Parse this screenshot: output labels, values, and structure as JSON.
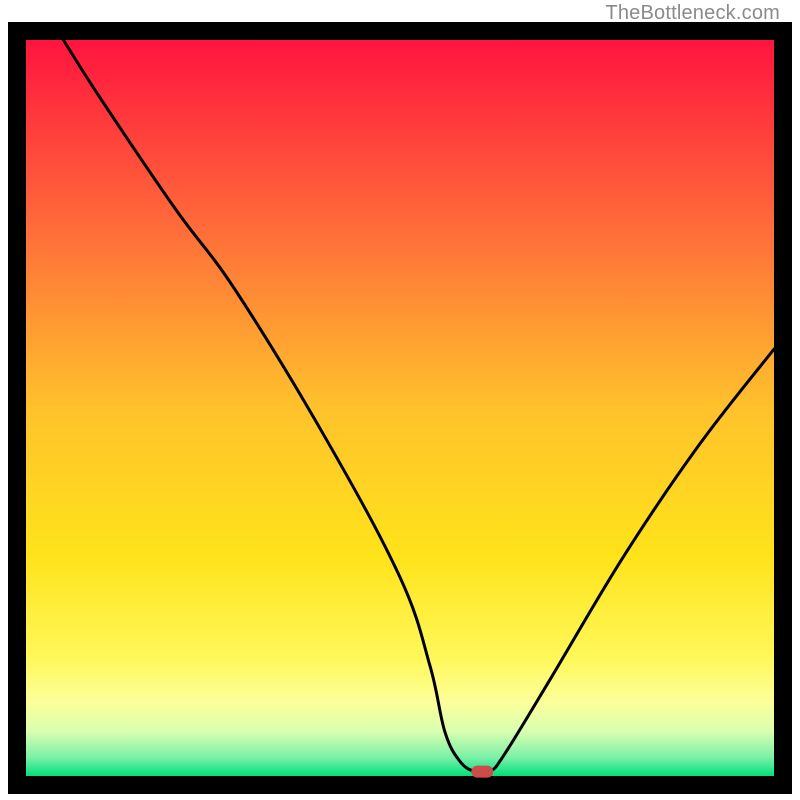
{
  "attribution": "TheBottleneck.com",
  "chart_data": {
    "type": "line",
    "title": "",
    "xlabel": "",
    "ylabel": "",
    "xlim": [
      0,
      100
    ],
    "ylim": [
      0,
      100
    ],
    "series": [
      {
        "name": "curve",
        "x": [
          5,
          10,
          20,
          28,
          40,
          50,
          54,
          56,
          58,
          60,
          62,
          64,
          70,
          80,
          90,
          100
        ],
        "y": [
          100,
          92,
          77,
          66,
          46,
          27,
          15,
          6,
          2,
          0.6,
          0.6,
          3,
          13,
          30,
          45,
          58
        ]
      }
    ],
    "marker": {
      "x": 61,
      "y": 0.6,
      "color": "#cc4b4b"
    },
    "gradient_stops": [
      {
        "offset": 0.0,
        "color": "#ff143e"
      },
      {
        "offset": 0.25,
        "color": "#ff6a3a"
      },
      {
        "offset": 0.5,
        "color": "#ffc22c"
      },
      {
        "offset": 0.7,
        "color": "#ffe31a"
      },
      {
        "offset": 0.84,
        "color": "#fff85a"
      },
      {
        "offset": 0.9,
        "color": "#fcff9a"
      },
      {
        "offset": 0.94,
        "color": "#d8ffb0"
      },
      {
        "offset": 0.975,
        "color": "#7af0a8"
      },
      {
        "offset": 1.0,
        "color": "#00e07a"
      }
    ],
    "border_color": "#000000",
    "border_width": 18
  }
}
